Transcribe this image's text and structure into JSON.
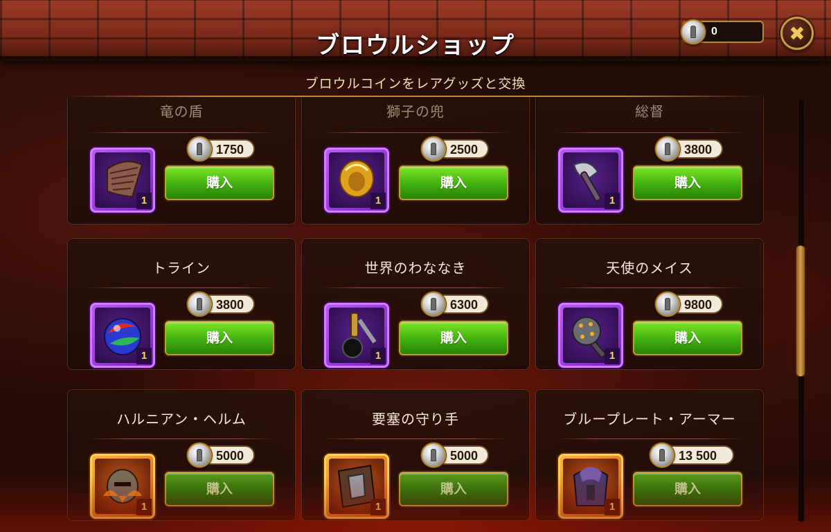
{
  "header": {
    "title": "ブロウルショップ",
    "currency_amount": "0",
    "currency_icon": "brawl-coin-icon",
    "close_icon": "close-icon",
    "subtitle": "ブロウルコインをレアグッズと交換"
  },
  "colors": {
    "buy_button": "#3fae0e",
    "frame_gold": "#c79a3f",
    "rarity_purple": "#b75bf5",
    "rarity_orange": "#ffb23a"
  },
  "items": [
    {
      "name": "竜の盾",
      "price": "1750",
      "qty": "1",
      "rarity": "purple",
      "icon": "dragon-shield-icon",
      "buy_label": "購入"
    },
    {
      "name": "獅子の兜",
      "price": "2500",
      "qty": "1",
      "rarity": "purple",
      "icon": "lion-helmet-icon",
      "buy_label": "購入"
    },
    {
      "name": "総督",
      "price": "3800",
      "qty": "1",
      "rarity": "purple",
      "icon": "axe-icon",
      "buy_label": "購入"
    },
    {
      "name": "トライン",
      "price": "3800",
      "qty": "1",
      "rarity": "purple",
      "icon": "orb-icon",
      "buy_label": "購入"
    },
    {
      "name": "世界のわななき",
      "price": "6300",
      "qty": "1",
      "rarity": "purple",
      "icon": "flail-icon",
      "buy_label": "購入"
    },
    {
      "name": "天使のメイス",
      "price": "9800",
      "qty": "1",
      "rarity": "purple",
      "icon": "mace-icon",
      "buy_label": "購入"
    },
    {
      "name": "ハルニアン・ヘルム",
      "price": "5000",
      "qty": "1",
      "rarity": "orange",
      "icon": "helm-icon",
      "buy_label": "購入"
    },
    {
      "name": "要塞の守り手",
      "price": "5000",
      "qty": "1",
      "rarity": "orange",
      "icon": "armor-plate-icon",
      "buy_label": "購入"
    },
    {
      "name": "ブループレート・アーマー",
      "price": "13 500",
      "qty": "1",
      "rarity": "orange",
      "icon": "blue-armor-icon",
      "buy_label": "購入"
    }
  ]
}
